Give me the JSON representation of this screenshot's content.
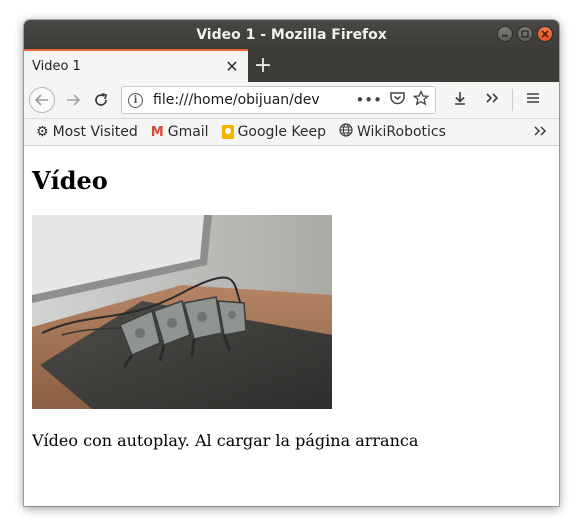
{
  "window": {
    "title": "Video 1 - Mozilla Firefox"
  },
  "tab": {
    "title": "Video 1",
    "close_glyph": "✕",
    "new_tab_glyph": "+"
  },
  "navbar": {
    "url": "file:///home/obijuan/dev",
    "page_actions_glyph": "•••"
  },
  "bookmarks": [
    {
      "label": "Most Visited",
      "icon": "gear-icon"
    },
    {
      "label": "Gmail",
      "icon": "gmail-icon"
    },
    {
      "label": "Google Keep",
      "icon": "keep-icon"
    },
    {
      "label": "WikiRobotics",
      "icon": "globe-icon"
    }
  ],
  "page": {
    "heading": "Vídeo",
    "paragraph": "Vídeo con autoplay. Al cargar la página arranca"
  },
  "colors": {
    "titlebar": "#3d3b37",
    "tab_accent": "#e7683a",
    "close_button": "#e2561f"
  }
}
